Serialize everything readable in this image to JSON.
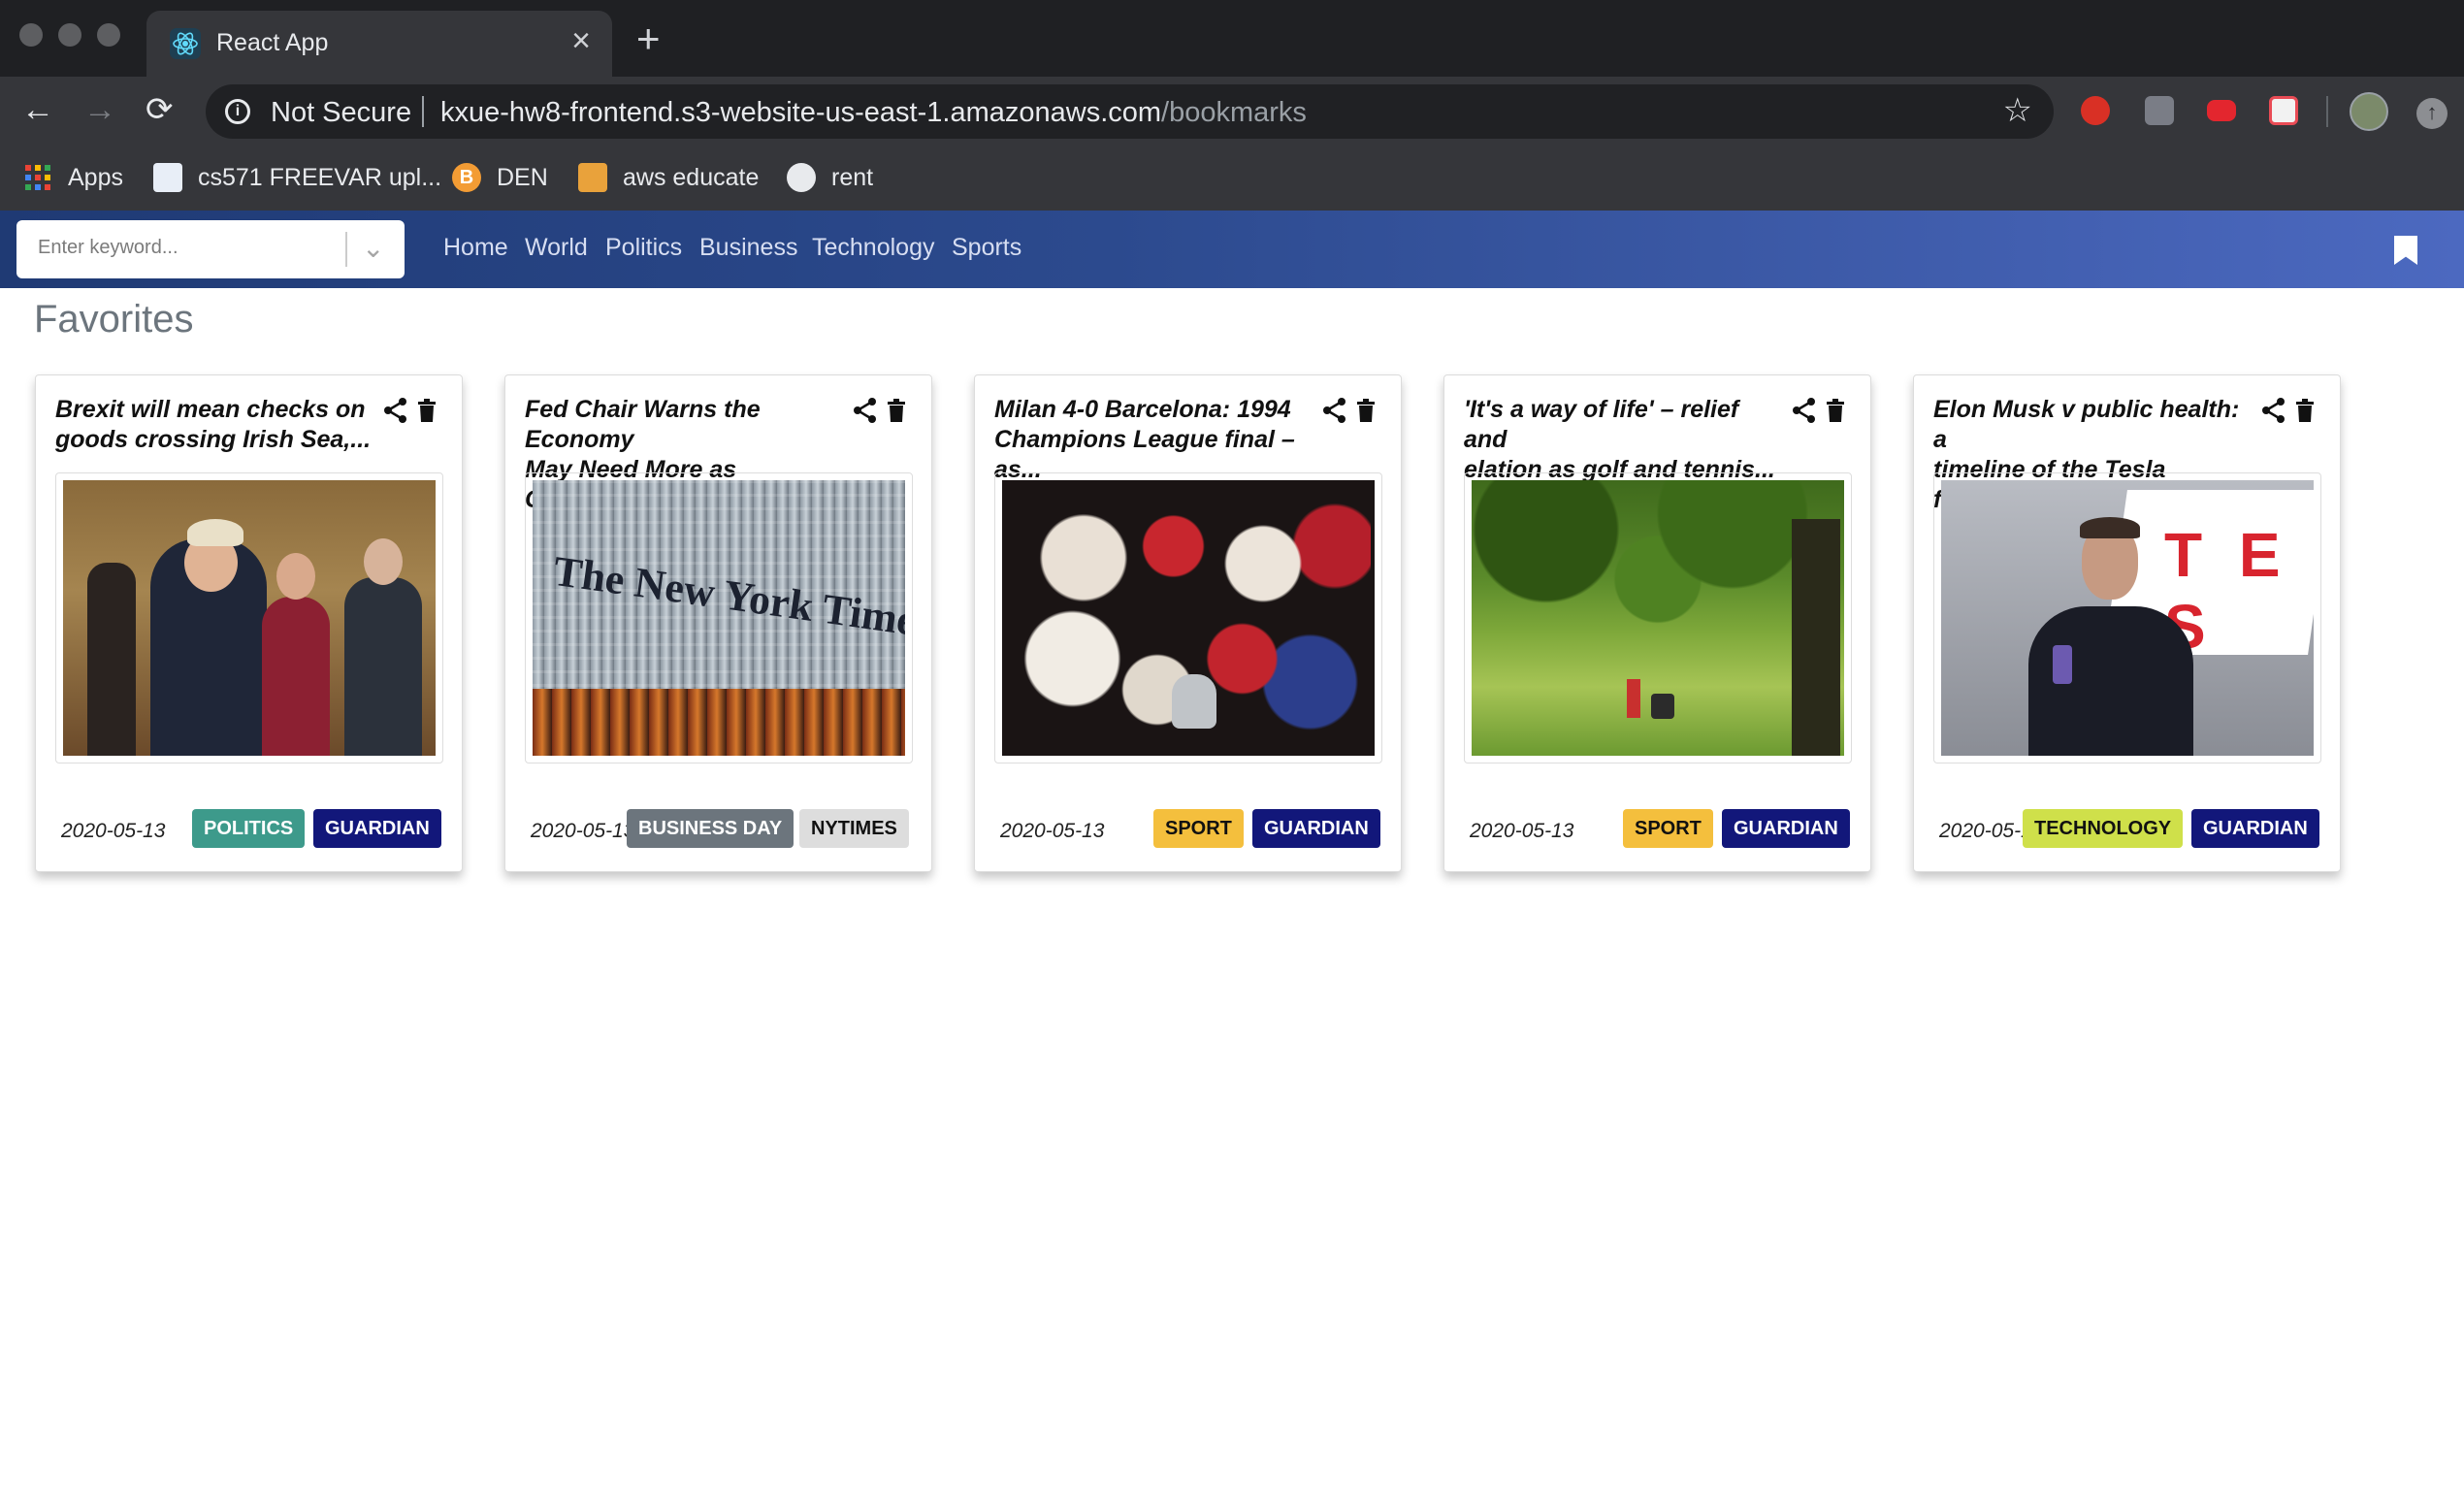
{
  "browser": {
    "tab_title": "React App",
    "security_label": "Not Secure",
    "url_host": "kxue-hw8-frontend.s3-website-us-east-1.amazonaws.com",
    "url_path": "/bookmarks",
    "bookmarks_bar": [
      {
        "label": "Apps",
        "icon": "apps-grid-icon"
      },
      {
        "label": "cs571 FREEVAR upl...",
        "icon": "bookmark-favicon"
      },
      {
        "label": "DEN",
        "icon": "bitcoin-icon"
      },
      {
        "label": "aws educate",
        "icon": "box-icon"
      },
      {
        "label": "rent",
        "icon": "globe-icon"
      }
    ]
  },
  "app": {
    "search_placeholder": "Enter keyword...",
    "nav": [
      "Home",
      "World",
      "Politics",
      "Business",
      "Technology",
      "Sports"
    ],
    "page_title": "Favorites"
  },
  "cards": [
    {
      "title_line1": "Brexit will mean checks on",
      "title_line2": "goods crossing Irish Sea,...",
      "date": "2020-05-13",
      "section": "POLITICS",
      "section_color": "#3d9a8b",
      "source": "GUARDIAN",
      "source_color": "#12177a"
    },
    {
      "title_line1": "Fed Chair Warns the Economy",
      "title_line2": "May Need More as Congres...",
      "date": "2020-05-13",
      "section": "BUSINESS DAY",
      "section_color": "#6c757d",
      "source": "NYTIMES",
      "source_color": "#dddddd"
    },
    {
      "title_line1": "Milan 4-0 Barcelona: 1994",
      "title_line2": "Champions League final – as...",
      "date": "2020-05-13",
      "section": "SPORT",
      "section_color": "#f4bf3d",
      "source": "GUARDIAN",
      "source_color": "#12177a"
    },
    {
      "title_line1": "'It's a way of life' – relief and",
      "title_line2": "elation as golf and tennis...",
      "date": "2020-05-13",
      "section": "SPORT",
      "section_color": "#f4bf3d",
      "source": "GUARDIAN",
      "source_color": "#12177a"
    },
    {
      "title_line1": "Elon Musk v public health: a",
      "title_line2": "timeline of the Tesla factory...",
      "date": "2020-05-13",
      "section": "TECHNOLOGY",
      "section_color": "#cfe04a",
      "source": "GUARDIAN",
      "source_color": "#12177a"
    }
  ]
}
